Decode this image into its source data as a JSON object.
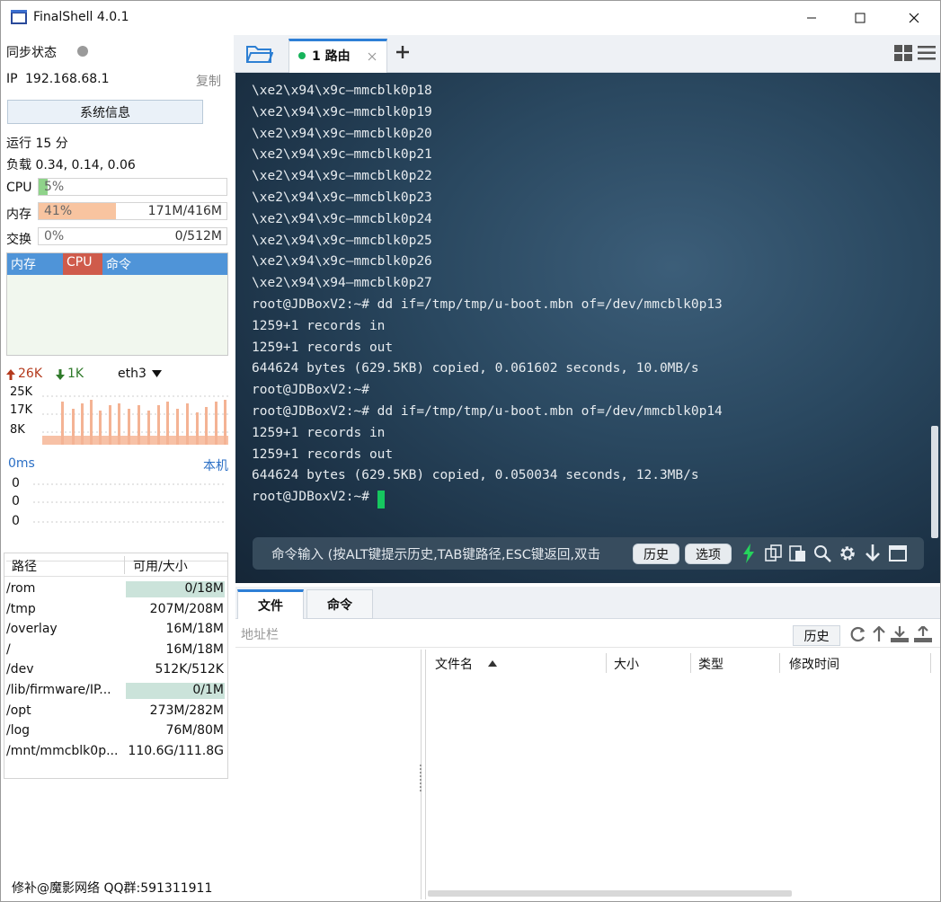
{
  "window": {
    "title": "FinalShell 4.0.1"
  },
  "left": {
    "sync_label": "同步状态",
    "ip_label": "IP",
    "ip": "192.168.68.1",
    "copy_label": "复制",
    "sysinfo_button": "系统信息",
    "uptime": "运行 15 分",
    "load": "负载 0.34, 0.14, 0.06",
    "cpu": {
      "label": "CPU",
      "percent_text": "5%",
      "fraction": 0.05,
      "color": "#8fd38a"
    },
    "mem": {
      "label": "内存",
      "percent_text": "41%",
      "fraction": 0.41,
      "amount": "171M/416M",
      "color": "#f8c4a0"
    },
    "swap": {
      "label": "交换",
      "percent_text": "0%",
      "fraction": 0.0,
      "amount": "0/512M"
    },
    "proc_tabs": [
      "内存",
      "CPU",
      "命令"
    ],
    "net": {
      "up": "26K",
      "down": "1K",
      "iface": "eth3",
      "y_ticks": [
        "25K",
        "17K",
        "8K"
      ]
    },
    "ping": {
      "latency": "0ms",
      "host": "本机",
      "values": [
        "0",
        "0",
        "0"
      ]
    },
    "disk": {
      "headers": [
        "路径",
        "可用/大小"
      ],
      "rows": [
        {
          "path": "/rom",
          "size": "0/18M",
          "used": 1.0
        },
        {
          "path": "/tmp",
          "size": "207M/208M",
          "used": 0.0
        },
        {
          "path": "/overlay",
          "size": "16M/18M",
          "used": 0.0
        },
        {
          "path": "/",
          "size": "16M/18M",
          "used": 0.0
        },
        {
          "path": "/dev",
          "size": "512K/512K",
          "used": 0.0
        },
        {
          "path": "/lib/firmware/IP...",
          "size": "0/1M",
          "used": 1.0
        },
        {
          "path": "/opt",
          "size": "273M/282M",
          "used": 0.0
        },
        {
          "path": "/log",
          "size": "76M/80M",
          "used": 0.0
        },
        {
          "path": "/mnt/mmcblk0p...",
          "size": "110.6G/111.8G",
          "used": 0.0
        }
      ]
    },
    "footer": "修补@魔影网络 QQ群:591311911"
  },
  "tabs": {
    "active_label": "1 路由"
  },
  "terminal": {
    "lines": [
      "\\xe2\\x94\\x9c—mmcblk0p18",
      "\\xe2\\x94\\x9c—mmcblk0p19",
      "\\xe2\\x94\\x9c—mmcblk0p20",
      "\\xe2\\x94\\x9c—mmcblk0p21",
      "\\xe2\\x94\\x9c—mmcblk0p22",
      "\\xe2\\x94\\x9c—mmcblk0p23",
      "\\xe2\\x94\\x9c—mmcblk0p24",
      "\\xe2\\x94\\x9c—mmcblk0p25",
      "\\xe2\\x94\\x9c—mmcblk0p26",
      "\\xe2\\x94\\x94—mmcblk0p27",
      "root@JDBoxV2:~# dd if=/tmp/tmp/u-boot.mbn of=/dev/mmcblk0p13",
      "1259+1 records in",
      "1259+1 records out",
      "644624 bytes (629.5KB) copied, 0.061602 seconds, 10.0MB/s",
      "root@JDBoxV2:~#",
      "root@JDBoxV2:~# dd if=/tmp/tmp/u-boot.mbn of=/dev/mmcblk0p14",
      "1259+1 records in",
      "1259+1 records out",
      "644624 bytes (629.5KB) copied, 0.050034 seconds, 12.3MB/s",
      "root@JDBoxV2:~# "
    ],
    "cmd_placeholder": "命令输入 (按ALT键提示历史,TAB键路径,ESC键返回,双击",
    "history_button": "历史",
    "options_button": "选项"
  },
  "files": {
    "tabs": [
      "文件",
      "命令"
    ],
    "address_placeholder": "地址栏",
    "history_button": "历史",
    "columns": [
      "文件名",
      "大小",
      "类型",
      "修改时间"
    ]
  }
}
